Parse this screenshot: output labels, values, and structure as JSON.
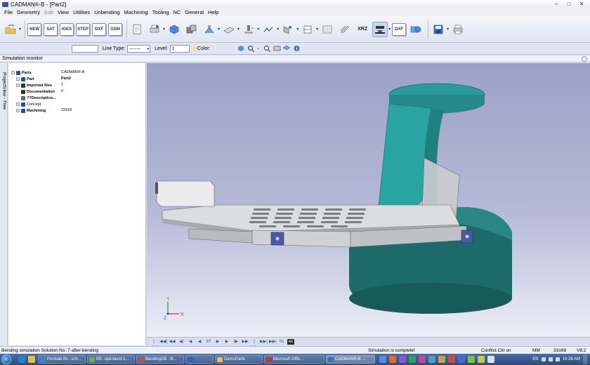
{
  "window": {
    "title": "CADMAN®-B - [Part2]",
    "controls": [
      "–",
      "□",
      "✕"
    ]
  },
  "menu": [
    {
      "label": "File",
      "enabled": true
    },
    {
      "label": "Geometry",
      "enabled": true
    },
    {
      "label": "Edit",
      "enabled": false
    },
    {
      "label": "View",
      "enabled": true
    },
    {
      "label": "Utilities",
      "enabled": true
    },
    {
      "label": "Unbending",
      "enabled": true
    },
    {
      "label": "Machining",
      "enabled": true
    },
    {
      "label": "Tooling",
      "enabled": true
    },
    {
      "label": "NC",
      "enabled": true
    },
    {
      "label": "General",
      "enabled": true
    },
    {
      "label": "Help",
      "enabled": true
    }
  ],
  "toolbar": {
    "labeled_buttons": [
      "NEW",
      "SAT",
      "IGES",
      "STEP",
      "DXF",
      "OSM"
    ],
    "xrz_label": "XRZ",
    "dxf2_label": "DXF",
    "icons": [
      "open-icon",
      "new-file-icon",
      "sat-file-icon",
      "iges-file-icon",
      "step-file-icon",
      "dxf-file-icon",
      "osm-file-icon",
      "document-icon",
      "print-icon",
      "cube-icon",
      "multi-cube-icon",
      "bend-tool-icon",
      "sheet-icon",
      "punch-icon",
      "measure-icon",
      "sheet-edit-icon",
      "flag-icon",
      "matrix-icon",
      "grid-icon",
      "xrz-icon",
      "press-brake-icon",
      "dxf-export-icon",
      "globe-icon",
      "save-icon",
      "printer-icon"
    ]
  },
  "propbar": {
    "name_value": "",
    "line_type_label": "Line Type:",
    "line_type_value": "--------",
    "level_label": "Level:",
    "level_value": "1",
    "color_label": "Color:"
  },
  "monitor": {
    "title": "Simulation monitor"
  },
  "side_tab": {
    "label": "ProjectView - Tree"
  },
  "tree": {
    "rows": [
      {
        "name": "Parts",
        "value": "CADMAN®-B",
        "bold": true,
        "value_bold": false,
        "indent": 0
      },
      {
        "name": "Part",
        "value": "Part2",
        "bold": true,
        "value_bold": true,
        "indent": 1
      },
      {
        "name": "Imported files",
        "value": "1",
        "bold": true,
        "value_bold": false,
        "indent": 2
      },
      {
        "name": "Documentation",
        "value": "0",
        "bold": true,
        "value_bold": false,
        "indent": 2
      },
      {
        "name": "??Description...",
        "value": "",
        "bold": true,
        "value_bold": false,
        "indent": 2
      },
      {
        "name": "Concept",
        "value": "",
        "bold": false,
        "value_bold": false,
        "indent": 1
      },
      {
        "name": "Machining",
        "value": "33169",
        "bold": true,
        "value_bold": false,
        "indent": 1
      }
    ]
  },
  "axes": {
    "x": "X",
    "y": "Y",
    "z": "Z"
  },
  "playback": {
    "buttons": [
      "|◀◀",
      "◀◀|",
      "◀◀",
      "◀|",
      "◀",
      "◀",
      "b?",
      "▶",
      "▶",
      "|▶",
      "▶▶",
      "|▶▶",
      "▶▶|",
      "▶▶|",
      "fix",
      "ex"
    ]
  },
  "status": {
    "left": "Bending simulation Solution No.:7-after-bending",
    "center": "Simulation is complete!",
    "conflict": "Conflict Ctrl on",
    "unit": "MM",
    "number": "33169",
    "version": "V8.2"
  },
  "taskbar": {
    "tasks": [
      {
        "label": "Postvak IN - szh...",
        "color": "#4a7fd0"
      },
      {
        "label": "RE: opti-bend s...",
        "color": "#6fb04a"
      },
      {
        "label": "BendingDB - B...",
        "color": "#d04a3a"
      },
      {
        "label": "",
        "color": "#2f63c0"
      },
      {
        "label": "DemoParts",
        "color": "#e6c04a"
      },
      {
        "label": "Microsoft Offic...",
        "color": "#c0392b"
      },
      {
        "label": "CADMAN®-B ...",
        "color": "#3a6fc8"
      }
    ],
    "tray_lang": "EN",
    "clock": "10:38 AM"
  },
  "colors": {
    "viewport_top": "#9ca2c7",
    "viewport_bottom": "#eceef7",
    "tool_teal": "#2e9e9e",
    "base_teal": "#1c6a6a",
    "sheet": "#c9cbcf"
  }
}
